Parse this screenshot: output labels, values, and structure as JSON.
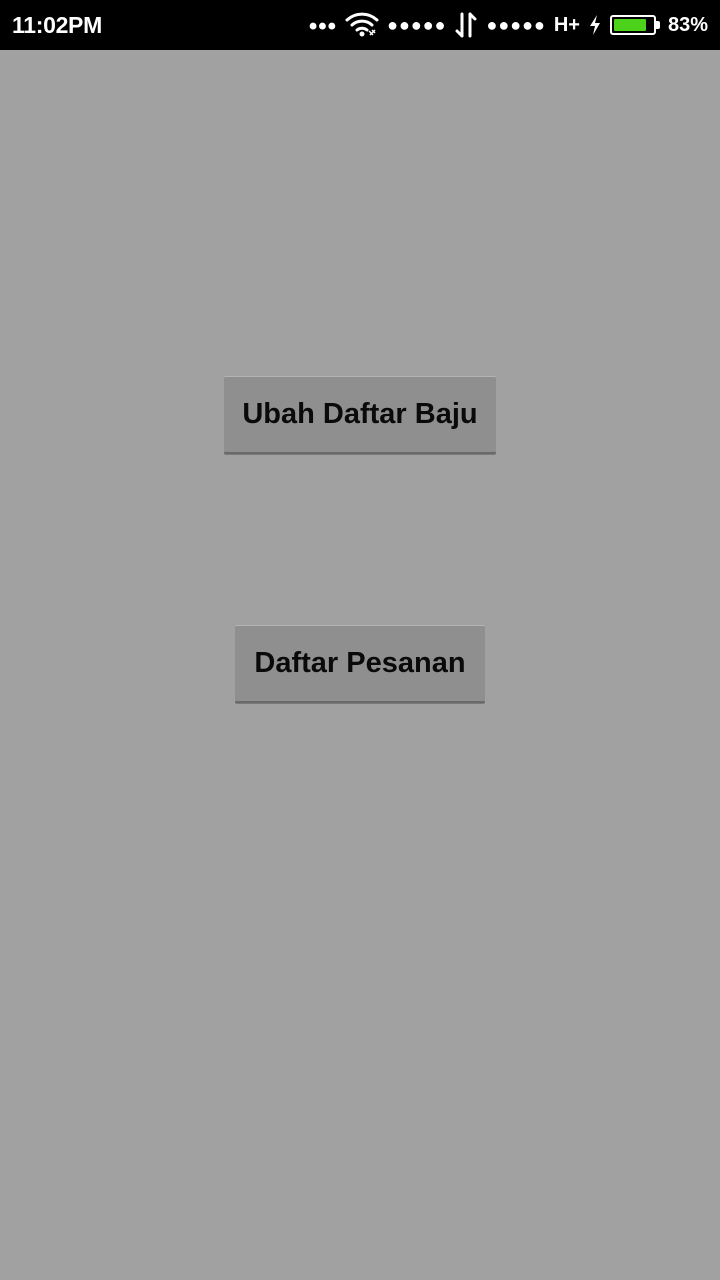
{
  "status_bar": {
    "time": "11:02PM",
    "more_dots": "•••",
    "signal_dots_1": "●●●●●",
    "signal_dots_2": "●●●●●",
    "network_type": "H+",
    "battery_percent": "83%",
    "battery_level": 0.83,
    "battery_color": "#4cd21b",
    "icons": [
      "wifi-icon",
      "data-transfer-icon",
      "charging-icon",
      "battery-icon"
    ]
  },
  "main": {
    "buttons": [
      {
        "label": "Ubah Daftar Baju"
      },
      {
        "label": "Daftar Pesanan"
      }
    ]
  },
  "colors": {
    "background": "#a1a1a1",
    "button": "#8f8f8f",
    "status_bar": "#000000"
  }
}
